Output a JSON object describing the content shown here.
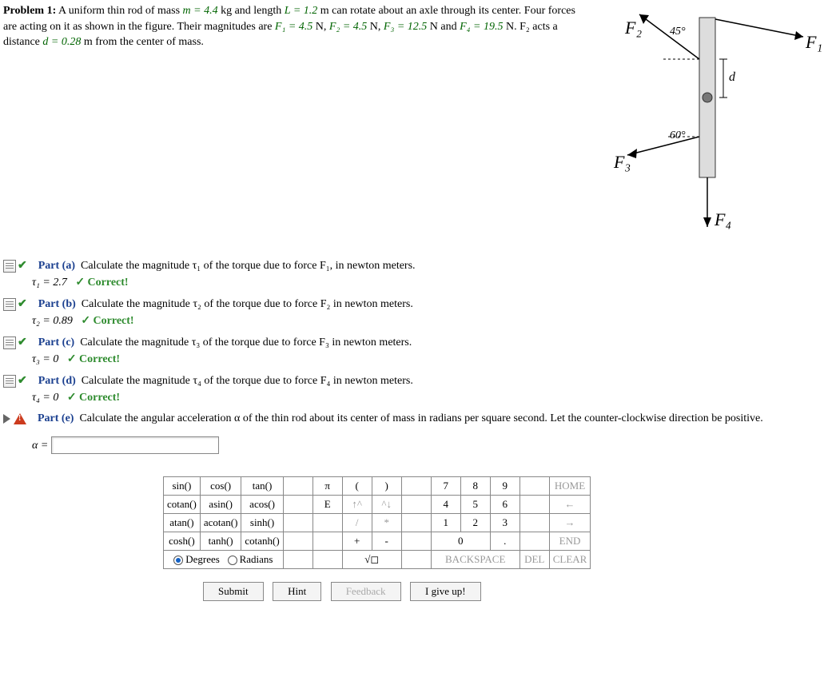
{
  "problem": {
    "label": "Problem 1:",
    "text_before": "A uniform thin rod of mass ",
    "m": "m = 4.4",
    "m_unit": " kg and length ",
    "L": "L = 1.2",
    "L_unit": " m can rotate about an axle through its center. Four forces are acting on it as shown in the figure. Their magnitudes are ",
    "F1": "F₁ = 4.5",
    "F2": "F₂ = 4.5",
    "F3": "F₃ = 12.5",
    "F4": "F₄ = 19.5",
    "forces_sep1": " N, ",
    "forces_sep2": " N, ",
    "forces_sep3": " N and ",
    "F4_unit": " N. ",
    "F2_acts": "F₂ acts a distance ",
    "d": "d = 0.28",
    "d_unit": " m from the center of mass."
  },
  "figure": {
    "F1": "F₁",
    "F2": "F₂",
    "F3": "F₃",
    "F4": "F₄",
    "a45": "45°",
    "a60": "60°",
    "d": "d"
  },
  "parts": {
    "a": {
      "title": "Part (a)",
      "prompt": "Calculate the magnitude τ₁ of the torque due to force F₁, in newton meters.",
      "ans_label": "τ₁ = 2.7",
      "status": "✓ Correct!"
    },
    "b": {
      "title": "Part (b)",
      "prompt": "Calculate the magnitude τ₂ of the torque due to force F₂ in newton meters.",
      "ans_label": "τ₂ = 0.89",
      "status": "✓ Correct!"
    },
    "c": {
      "title": "Part (c)",
      "prompt": "Calculate the magnitude τ₃ of the torque due to force F₃ in newton meters.",
      "ans_label": "τ₃ = 0",
      "status": "✓ Correct!"
    },
    "d": {
      "title": "Part (d)",
      "prompt": "Calculate the magnitude τ₄ of the torque due to force F₄ in newton meters.",
      "ans_label": "τ₄ = 0",
      "status": "✓ Correct!"
    },
    "e": {
      "title": "Part (e)",
      "prompt": "Calculate the angular acceleration α of the thin rod about its center of mass in radians per square second. Let the counter-clockwise direction be positive.",
      "alpha": "α ="
    }
  },
  "calc": {
    "r1": [
      "sin()",
      "cos()",
      "tan()",
      "π",
      "(",
      ")",
      "7",
      "8",
      "9",
      "HOME"
    ],
    "r2": [
      "cotan()",
      "asin()",
      "acos()",
      "E",
      "↑^",
      "^↓",
      "4",
      "5",
      "6",
      "←"
    ],
    "r3": [
      "atan()",
      "acotan()",
      "sinh()",
      "",
      "/",
      "*",
      "1",
      "2",
      "3",
      "→"
    ],
    "r4": [
      "cosh()",
      "tanh()",
      "cotanh()",
      "",
      "+",
      "-",
      "0",
      ".",
      "END"
    ],
    "r5": [
      "Degrees",
      "Radians",
      "√◻",
      "BACKSPACE",
      "DEL",
      "CLEAR"
    ]
  },
  "buttons": {
    "submit": "Submit",
    "hint": "Hint",
    "feedback": "Feedback",
    "giveup": "I give up!"
  }
}
